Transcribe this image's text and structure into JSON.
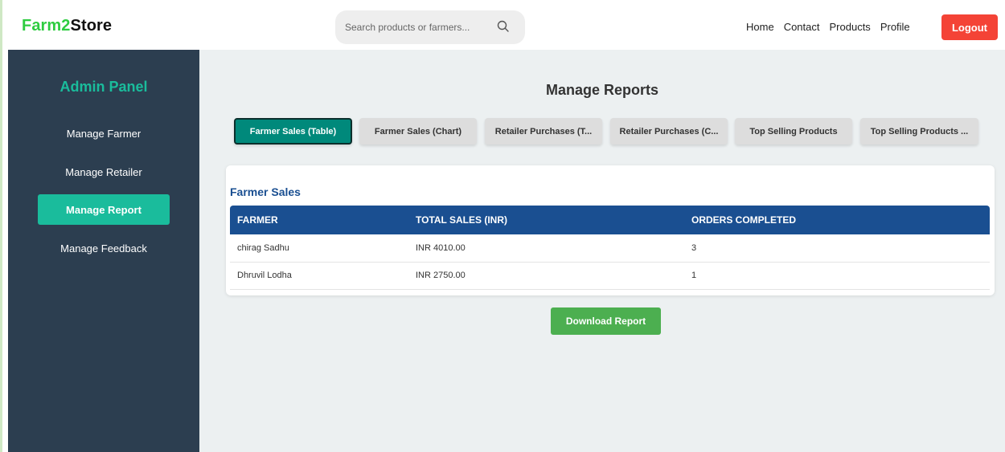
{
  "brand": {
    "part1": "Farm2",
    "part2": "Store"
  },
  "search": {
    "placeholder": "Search products or farmers..."
  },
  "nav": {
    "home": "Home",
    "contact": "Contact",
    "products": "Products",
    "profile": "Profile",
    "logout": "Logout"
  },
  "sidebar": {
    "title": "Admin Panel",
    "items": [
      {
        "label": "Manage Farmer",
        "active": false
      },
      {
        "label": "Manage Retailer",
        "active": false
      },
      {
        "label": "Manage Report",
        "active": true
      },
      {
        "label": "Manage Feedback",
        "active": false
      }
    ]
  },
  "main": {
    "title": "Manage Reports",
    "tabs": [
      {
        "label": "Farmer Sales (Table)",
        "active": true
      },
      {
        "label": "Farmer Sales (Chart)",
        "active": false
      },
      {
        "label": "Retailer Purchases (T...",
        "active": false
      },
      {
        "label": "Retailer Purchases (C...",
        "active": false
      },
      {
        "label": "Top Selling Products",
        "active": false
      },
      {
        "label": "Top Selling Products ...",
        "active": false
      }
    ],
    "section_title": "Farmer Sales",
    "table": {
      "headers": [
        "FARMER",
        "TOTAL SALES (INR)",
        "ORDERS COMPLETED"
      ],
      "rows": [
        [
          "chirag Sadhu",
          "INR 4010.00",
          "3"
        ],
        [
          "Dhruvil Lodha",
          "INR 2750.00",
          "1"
        ]
      ]
    },
    "download_label": "Download Report"
  },
  "colors": {
    "brand_green": "#2ecc40",
    "sidebar_bg": "#2c3e50",
    "accent_teal": "#1abc9c",
    "table_header": "#1a4f91",
    "logout_red": "#f44336",
    "download_green": "#4caf50"
  }
}
